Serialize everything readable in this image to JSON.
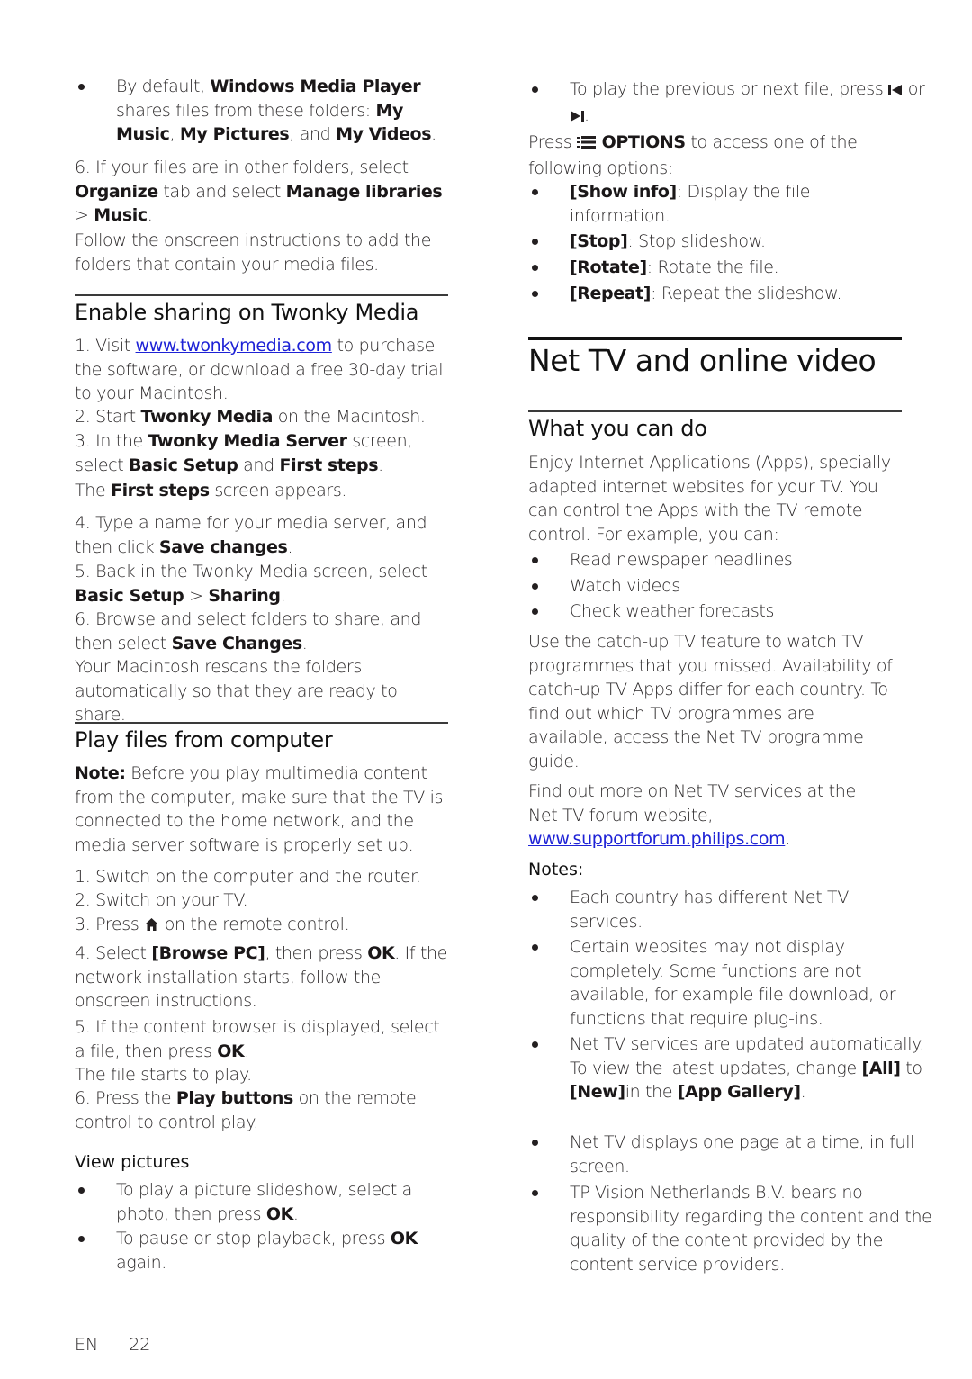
{
  "left": {
    "wmp_bullet": {
      "t1": "By default, ",
      "b1": "Windows Media Player",
      "t2": " shares files from these folders: ",
      "b2": "My Music",
      "t3": ", ",
      "b3": "My Pictures",
      "t4": ", and ",
      "b4": "My Videos",
      "t5": "."
    },
    "step6": {
      "t1": "6. If your files are in other folders, select ",
      "b1": "Organize",
      "t2": " tab and select ",
      "b2": "Manage libraries",
      "t3": " > ",
      "b3": "Music",
      "t4": "."
    },
    "follow": "Follow the onscreen instructions to add the folders that contain your media files.",
    "twonky": {
      "heading": "Enable sharing on Twonky Media",
      "s1": {
        "t1": "1. Visit ",
        "link": "www.twonkymedia.com",
        "t2": " to purchase the software, or download a free 30-day trial to your Macintosh."
      },
      "s2": {
        "t1": "2. Start ",
        "b1": "Twonky Media",
        "t2": " on the Macintosh."
      },
      "s3": {
        "t1": "3. In the ",
        "b1": "Twonky Media Server",
        "t2": " screen, select ",
        "b2": "Basic Setup",
        "t3": " and ",
        "b3": "First steps",
        "t4": "."
      },
      "s3b": {
        "t1": "The ",
        "b1": "First steps",
        "t2": " screen appears."
      },
      "s4": {
        "t1": "4. Type a name for your media server, and then click ",
        "b1": "Save changes",
        "t2": "."
      },
      "s5": {
        "t1": "5. Back in the Twonky Media screen, select ",
        "b1": "Basic Setup",
        "t2": " > ",
        "b2": "Sharing",
        "t3": "."
      },
      "s6": {
        "t1": "6. Browse and select folders to share, and then select ",
        "b1": "Save Changes",
        "t2": "."
      },
      "rescan": "Your Macintosh rescans the folders automatically so that they are ready to share."
    },
    "play": {
      "heading": "Play files from computer",
      "note": {
        "b1": "Note:",
        "t1": " Before you play multimedia content from the computer, make sure that the TV is connected to the home network, and the media server software is properly set up."
      },
      "s1": "1. Switch on the computer and the router.",
      "s2": "2. Switch on your TV.",
      "s3": {
        "t1": "3. Press ",
        "icon": "home-icon",
        "t2": " on the remote control."
      },
      "s4": {
        "t1": "4. Select ",
        "b1": "[Browse PC]",
        "t2": ", then press ",
        "b2": "OK",
        "t3": ". If the network installation starts, follow the onscreen instructions."
      },
      "s5": {
        "t1": "5. If the content browser is displayed, select a file, then press ",
        "b1": "OK",
        "t2": "."
      },
      "s5b": "The file starts to play.",
      "s6": {
        "t1": "6. Press the ",
        "b1": "Play buttons",
        "t2": " on the remote control to control play."
      },
      "view_pictures": "View pictures",
      "vp1": {
        "t1": "To play a picture slideshow, select a photo, then press ",
        "b1": "OK",
        "t2": "."
      },
      "vp2": {
        "t1": "To pause or stop playback, press ",
        "b1": "OK",
        "t2": " again."
      }
    }
  },
  "right": {
    "prev_next": {
      "t1": "To play the previous or next file, press ",
      "icon1": "skip-previous-icon",
      "t2": " or ",
      "icon2": "skip-next-icon",
      "t3": "."
    },
    "options": {
      "t1": "Press ",
      "icon": "options-icon",
      "b1": "OPTIONS",
      "t2": " to access one of the following options:"
    },
    "option_items": [
      {
        "b": "[Show info]",
        "t": ": Display the file information."
      },
      {
        "b": "[Stop]",
        "t": ": Stop slideshow."
      },
      {
        "b": "[Rotate]",
        "t": ": Rotate the file."
      },
      {
        "b": "[Repeat]",
        "t": ": Repeat the slideshow."
      }
    ],
    "chapter_title": "Net TV and online video",
    "what": {
      "heading": "What you can do",
      "intro": "Enjoy Internet Applications (Apps), specially adapted internet websites for your TV. You can control the Apps with the TV remote control. For example, you can:",
      "examples": [
        "Read newspaper headlines",
        "Watch videos",
        "Check weather forecasts"
      ],
      "catchup": "Use the catch-up TV feature to watch TV programmes that you missed. Availability of catch-up TV Apps differ for each country. To find out which TV programmes are available, access the Net TV programme guide.",
      "findout": {
        "t1": "Find out more on Net TV services at the Net TV forum website, ",
        "link": "www.supportforum.philips.com",
        "t2": "."
      },
      "notes_label": "Notes:",
      "notes": [
        {
          "t1": "Each country has different Net TV services."
        },
        {
          "t1": "Certain websites may not display completely. Some functions are not available, for example file download, or functions that require plug-ins."
        },
        {
          "t1": "Net TV services are updated automatically. To view the latest updates, change ",
          "b1": "[All]",
          "t2": " to ",
          "b2": "[New]",
          "t3": "in the ",
          "b3": "[App Gallery]",
          "t4": "."
        },
        {
          "t1": "Net TV displays one page at a time, in full screen."
        },
        {
          "t1": "TP Vision Netherlands B.V. bears no responsibility regarding the content and the quality of the content provided by the content service providers."
        }
      ]
    }
  },
  "footer": {
    "lang": "EN",
    "page": "22"
  },
  "colors": {
    "link": "#1e22d6",
    "text": "#231f20"
  }
}
